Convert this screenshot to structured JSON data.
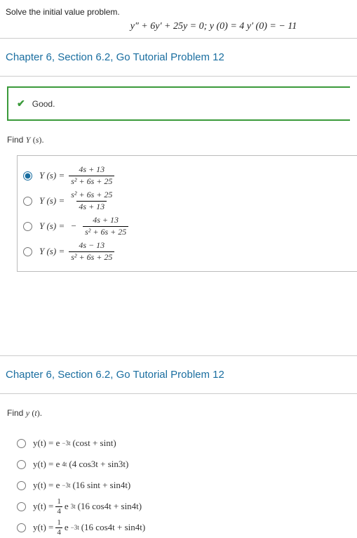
{
  "prompt": {
    "text": "Solve the initial value problem.",
    "equation": "y″ + 6y′ + 25y = 0;   y (0) = 4  y′ (0) = − 11"
  },
  "section1": {
    "header": "Chapter 6, Section 6.2, Go Tutorial Problem 12",
    "feedback": "Good.",
    "find_label": "Find Y (s).",
    "options": [
      {
        "lhs": "Y (s) =",
        "num": "4s + 13",
        "den": "s² + 6s + 25",
        "sign": "",
        "selected": true
      },
      {
        "lhs": "Y (s) =",
        "num": "s² + 6s + 25",
        "den": "4s + 13",
        "sign": "",
        "selected": false
      },
      {
        "lhs": "Y (s) =",
        "num": "4s + 13",
        "den": "s² + 6s + 25",
        "sign": "−",
        "selected": false
      },
      {
        "lhs": "Y (s) =",
        "num": "4s − 13",
        "den": "s² + 6s + 25",
        "sign": "",
        "selected": false
      }
    ]
  },
  "section2": {
    "header": "Chapter 6, Section 6.2, Go Tutorial Problem 12",
    "find_label": "Find y (t).",
    "options": [
      {
        "text_html": "y(t) = e<sup>−3t</sup> (cost + sint)"
      },
      {
        "text_html": "y(t) = e<sup>4t</sup> (4 cos3t + sin3t)"
      },
      {
        "text_html": "y(t) = e<sup>−3t</sup> (16 sint + sin4t)"
      },
      {
        "frac_html": "y(t) = |FRAC14| e<sup>3t</sup> (16 cos4t + sin4t)"
      },
      {
        "frac_html": "y(t) = |FRAC14| e<sup>−3t</sup> (16 cos4t + sin4t)"
      }
    ]
  }
}
